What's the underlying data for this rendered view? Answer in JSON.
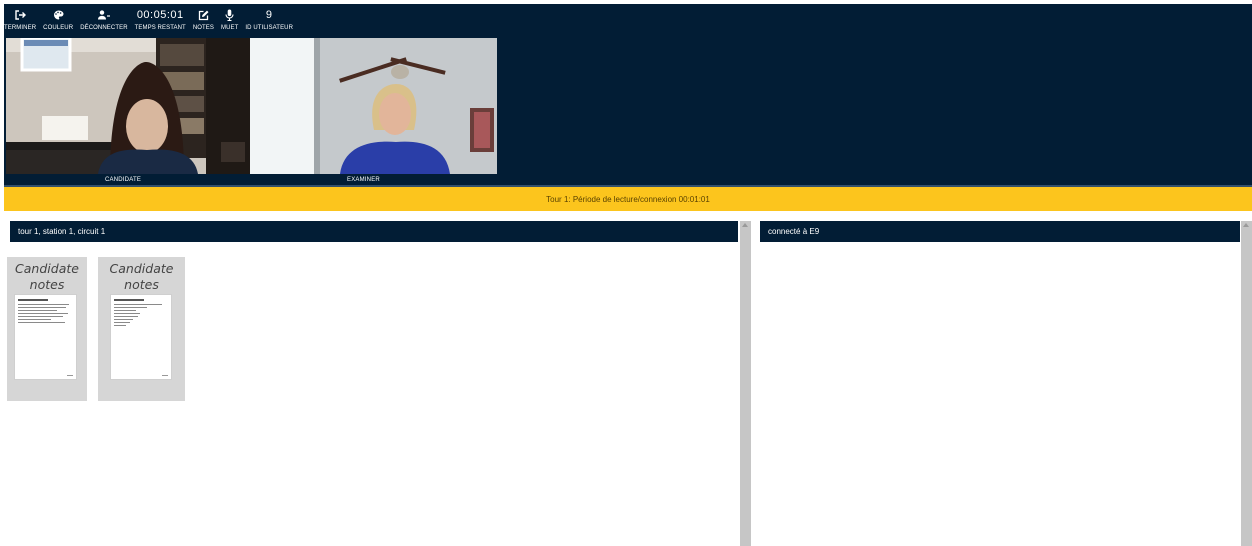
{
  "toolbar": {
    "terminate_label": "TERMINER",
    "color_label": "COULEUR",
    "disconnect_label": "DÉCONNECTER",
    "time_value": "00:05:01",
    "time_label": "TEMPS RESTANT",
    "notes_label": "NOTES",
    "mute_label": "MUET",
    "user_id_value": "9",
    "user_id_label": "ID UTILISATEUR"
  },
  "videos": {
    "candidate_label": "CANDIDATE",
    "examiner_label": "EXAMINER"
  },
  "banner": {
    "text": "Tour 1: Période de lecture/connexion 00:01:01",
    "color": "#fcc51d"
  },
  "left_panel": {
    "header": "tour 1, station 1, circuit 1",
    "cards": [
      {
        "title_line1": "Candidate",
        "title_line2": "notes"
      },
      {
        "title_line1": "Candidate",
        "title_line2": "notes"
      }
    ]
  },
  "right_panel": {
    "header": "connecté à E9"
  },
  "theme": {
    "navy": "#021d35",
    "accent": "#fcc51d"
  }
}
